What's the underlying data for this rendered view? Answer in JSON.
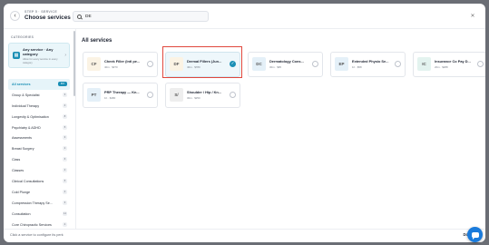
{
  "header": {
    "step": "STEP 5 · SERVICE",
    "title": "Choose services",
    "search_value": "DE",
    "back_icon": "arrow-left-icon",
    "close_icon": "close-icon"
  },
  "sidebar": {
    "heading": "CATEGORIES",
    "any_service": {
      "title": "Any service · Any category",
      "description": "Allow for every service in every category"
    },
    "categories": [
      {
        "label": "All services",
        "count": "657",
        "active": true
      },
      {
        "label": "Group & Specialist",
        "count": "3"
      },
      {
        "label": "Individual Therapy",
        "count": "4"
      },
      {
        "label": "Longevity & Optimisation",
        "count": "8"
      },
      {
        "label": "Psychiatry & ADHD",
        "count": "5"
      },
      {
        "label": "Assessments",
        "count": "3"
      },
      {
        "label": "Breast Surgery",
        "count": "2"
      },
      {
        "label": "Class",
        "count": "6"
      },
      {
        "label": "Classes",
        "count": "2"
      },
      {
        "label": "Clinical Consultations",
        "count": "5"
      },
      {
        "label": "Cold Plunge",
        "count": "2"
      },
      {
        "label": "Compression Therapy Se...",
        "count": "3"
      },
      {
        "label": "Consultation",
        "count": "14"
      },
      {
        "label": "Core Chiropractic Services",
        "count": "4"
      }
    ]
  },
  "main": {
    "title": "All services",
    "services": [
      {
        "initials": "CF",
        "name": "Cheek Filler (Intl pe...",
        "meta": "40m  ·  $370",
        "thumb_color": "#fbf3e4",
        "selected": false
      },
      {
        "initials": "DF",
        "name": "Dermal Fillers (Jun...",
        "meta": "40m  ·  $780",
        "thumb_color": "#fbf3e4",
        "selected": true
      },
      {
        "initials": "DC",
        "name": "Dermatology Cons...",
        "meta": "30m  ·  $95",
        "thumb_color": "#e4f0f8",
        "selected": false
      },
      {
        "initials": "EP",
        "name": "Extended Physio Se...",
        "meta": "1h  ·  $58",
        "thumb_color": "#e4f0f8",
        "selected": false
      },
      {
        "initials": "IC",
        "name": "Insurance Co Pay D...",
        "meta": "20m  ·  $288",
        "thumb_color": "#e3f3ef",
        "selected": false
      },
      {
        "initials": "PT",
        "name": "PRP Therapy — Kn...",
        "meta": "1h  ·  $480",
        "thumb_color": "#e4f0f8",
        "selected": false
      },
      {
        "initials": "S/",
        "name": "Shoulder / Hip / Kn...",
        "meta": "30m  ·  $250",
        "thumb_color": "#eeeeee",
        "selected": false
      }
    ]
  },
  "footer": {
    "hint": "Click a service to configure its perk",
    "done_label": "Done"
  },
  "colors": {
    "accent": "#1a8fb5",
    "highlight": "#e0483e",
    "chat": "#1a7bdc"
  }
}
